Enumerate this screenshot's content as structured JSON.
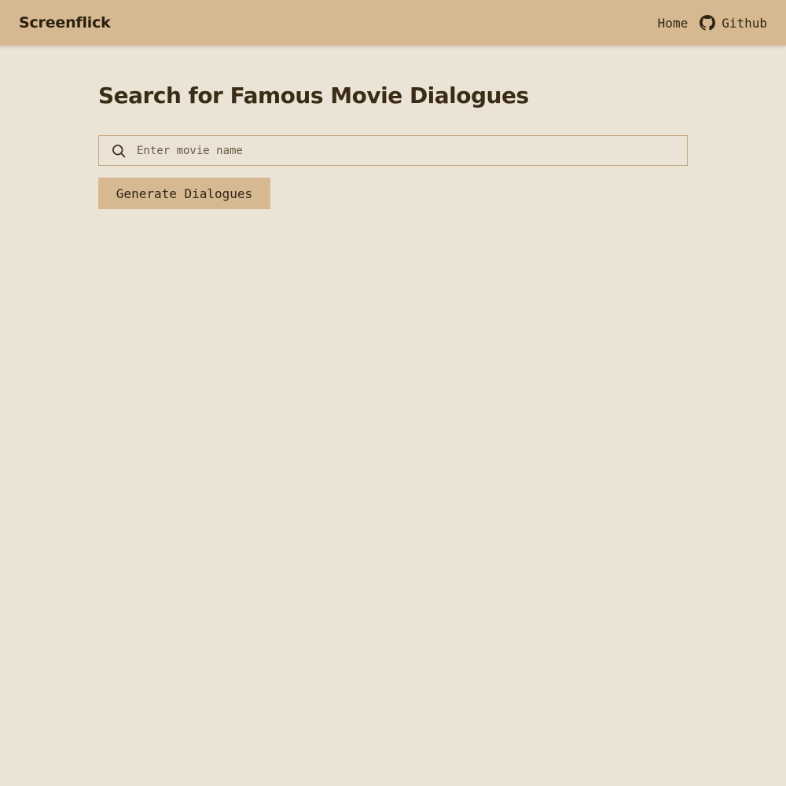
{
  "header": {
    "brand": "Screenflick",
    "nav": {
      "home_label": "Home",
      "github_label": "Github",
      "github_icon": "github-icon"
    }
  },
  "main": {
    "title": "Search for Famous Movie Dialogues",
    "search": {
      "icon": "search-icon",
      "value": "",
      "placeholder": "Enter movie name"
    },
    "generate_label": "Generate Dialogues"
  },
  "colors": {
    "page_background": "#ebe3d5",
    "header_background": "#d6b991",
    "button_background": "#d6b991",
    "input_border": "#c4a77d",
    "text": "#2f2414"
  }
}
